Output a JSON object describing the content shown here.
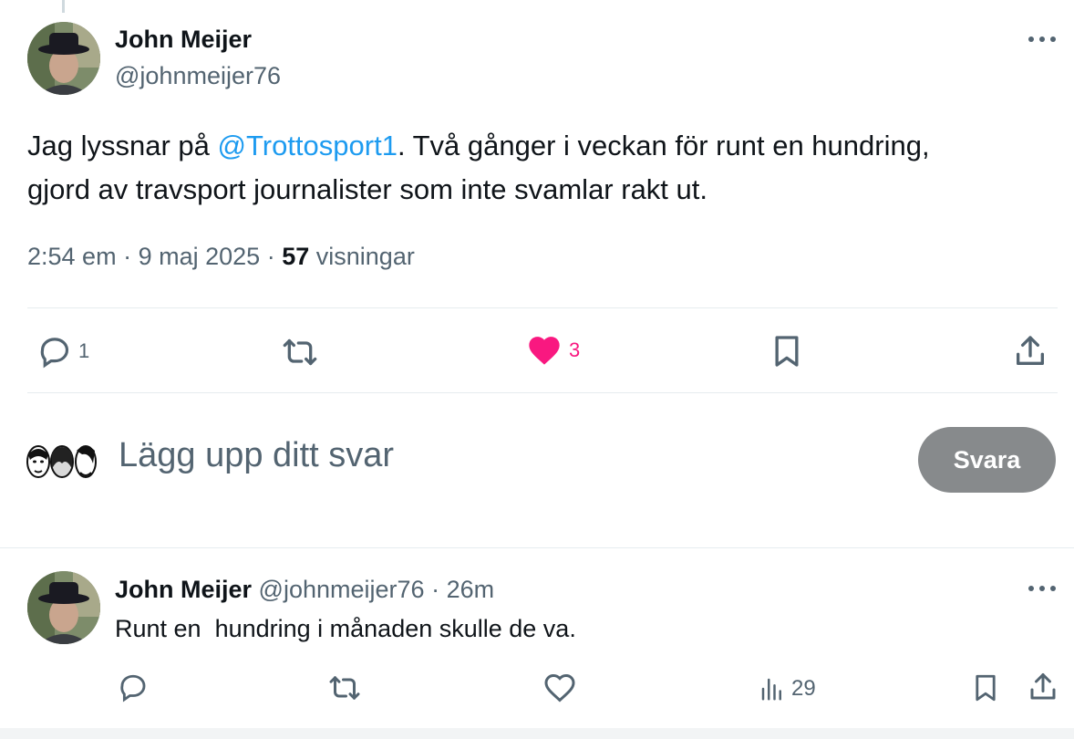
{
  "main_tweet": {
    "author_name": "John Meijer",
    "author_handle": "@johnmeijer76",
    "text_before_mention": "Jag lyssnar på ",
    "mention": "@Trottosport1",
    "text_after_mention": ". Två gånger i veckan för runt en hundring,",
    "text_line2": "gjord av travsport journalister som inte svamlar rakt ut.",
    "time": "2:54 em",
    "date": "9 maj 2025",
    "separator": "·",
    "views_count": "57",
    "views_label": "visningar",
    "actions": {
      "reply_count": "1",
      "like_count": "3"
    }
  },
  "reply_box": {
    "placeholder": "Lägg upp ditt svar",
    "button_label": "Svara"
  },
  "reply_tweet": {
    "author_name": "John Meijer",
    "author_handle": "@johnmeijer76",
    "separator": "·",
    "time_ago": "26m",
    "text": "Runt en  hundring i månaden skulle de va.",
    "views_count": "29"
  },
  "colors": {
    "accent": "#1d9bf0",
    "like": "#f91880",
    "secondary_text": "#536471",
    "button_disabled": "#878a8c"
  },
  "icons": [
    "more-icon",
    "reply-icon",
    "retweet-icon",
    "heart-icon",
    "bookmark-icon",
    "share-icon",
    "views-icon"
  ]
}
